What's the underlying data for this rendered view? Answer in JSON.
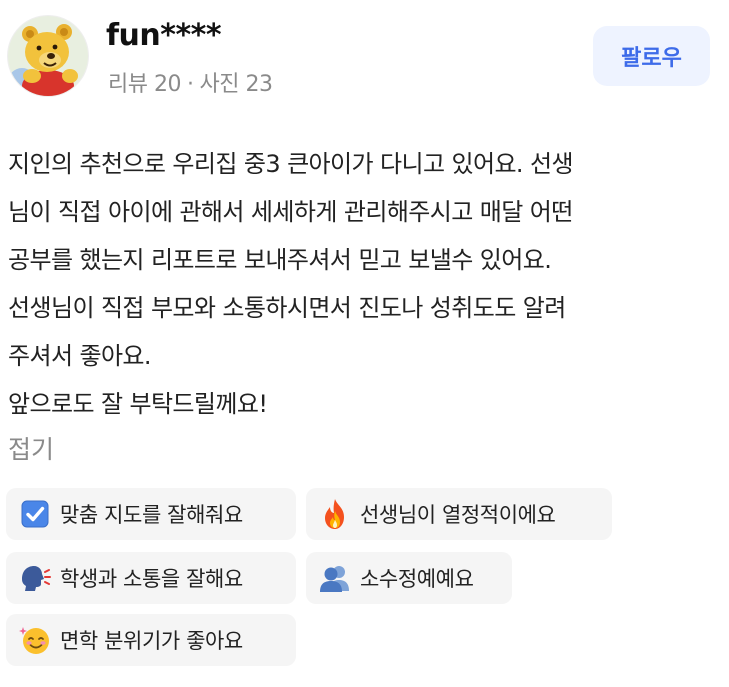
{
  "user": {
    "name": "fun****",
    "reviews_label": "리뷰 20",
    "separator": "·",
    "photos_label": "사진 23"
  },
  "follow_button": {
    "label": "팔로우",
    "color": "#3d6be9",
    "background": "#eef3ff"
  },
  "review": {
    "lines": [
      "지인의 추천으로 우리집 중3 큰아이가 다니고 있어요. 선생",
      "님이 직접 아이에 관해서 세세하게 관리해주시고 매달 어떤",
      "공부를 했는지 리포트로 보내주셔서 믿고 보낼수 있어요.",
      "선생님이 직접 부모와 소통하시면서 진도나 성취도도 알려",
      "주셔서 좋아요.",
      "앞으로도 잘 부탁드릴께요!"
    ],
    "collapse_label": "접기"
  },
  "tags": [
    {
      "icon": "checkbox-icon",
      "label": "맞춤 지도를 잘해줘요"
    },
    {
      "icon": "fire-icon",
      "label": "선생님이 열정적이에요"
    },
    {
      "icon": "speaking-head-icon",
      "label": "학생과 소통을 잘해요"
    },
    {
      "icon": "people-icon",
      "label": "소수정예예요"
    },
    {
      "icon": "smiling-face-icon",
      "label": "면학 분위기가 좋아요"
    }
  ]
}
